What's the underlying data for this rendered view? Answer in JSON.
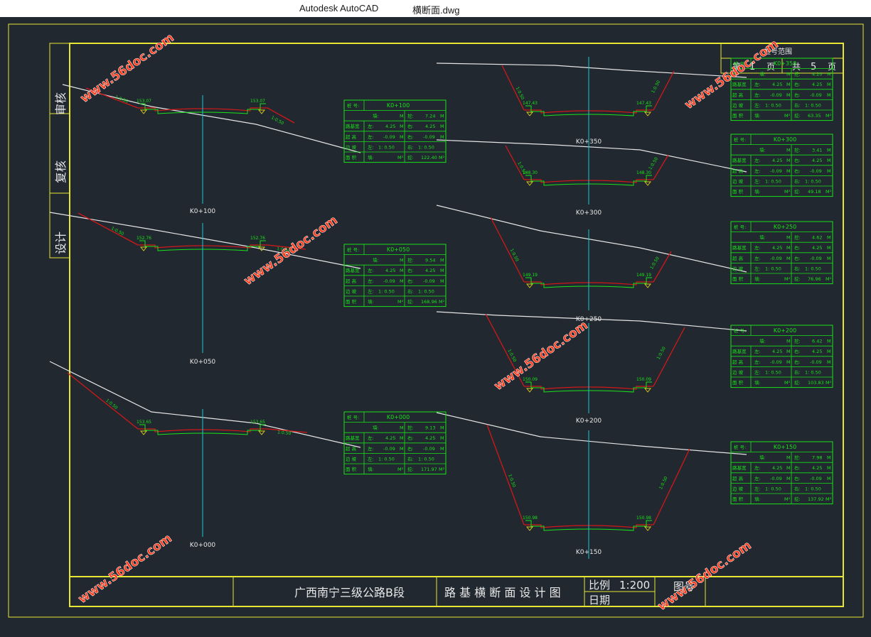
{
  "window": {
    "app_title": "Autodesk AutoCAD",
    "document_title": "横断面.dwg"
  },
  "colors": {
    "background": "#212830",
    "frame": "#e6e633",
    "cut_slope": "#d11818",
    "ground_line": "#e5e5e5",
    "centerline": "#19c8d2",
    "table": "#19e219",
    "watermark": "#ff3a1a"
  },
  "side_labels": {
    "review": "审核",
    "recheck": "复核",
    "design": "设计"
  },
  "title_block": {
    "project": "广西南宁三级公路B段",
    "drawing_name": "路 基 横 断 面 设 计 图",
    "scale_label": "比例",
    "scale_value": "1:200",
    "date_label": "日期",
    "drawing_no_label": "图号"
  },
  "page_box": {
    "header": "桩号范围",
    "page_prefix": "第",
    "page_no": "1",
    "page_unit": "页",
    "total_prefix": "共",
    "total_pages": "5",
    "total_unit": "页"
  },
  "watermark": "www.56doc.com",
  "table_labels": {
    "r0": [
      "桩 号:"
    ],
    "r1": [
      "填:",
      "M",
      "挖:",
      "M"
    ],
    "r2": [
      "路基宽",
      "左:",
      "M",
      "右:",
      "M"
    ],
    "r3": [
      "超 高",
      "左:",
      "M",
      "右:",
      "M"
    ],
    "r4": [
      "边 坡",
      "左:",
      "右:"
    ],
    "r5": [
      "面 积",
      "填:",
      "M²",
      "挖:",
      "M²"
    ]
  },
  "sections": [
    {
      "station": "K0+100",
      "dig": "7.24",
      "width_left": "4.25",
      "width_right": "4.25",
      "superelev_left": "-0.09",
      "superelev_right": "-0.09",
      "slope_left": "1: 0.50",
      "slope_right": "1: 0.50",
      "area_cut": "122.40",
      "elev_left": "153.07",
      "elev_right": "153.07",
      "slope_text_left": "1:0.50",
      "slope_text_right": "1:0.50"
    },
    {
      "station": "K0+050",
      "dig": "9.54",
      "width_left": "4.25",
      "width_right": "4.25",
      "superelev_left": "-0.09",
      "superelev_right": "-0.09",
      "slope_left": "1: 0.50",
      "slope_right": "1: 0.50",
      "area_cut": "168.96",
      "elev_left": "152.76",
      "elev_right": "152.76",
      "slope_text_left": "1:0.50",
      "slope_text_right": "1:0.50"
    },
    {
      "station": "K0+000",
      "dig": "9.13",
      "width_left": "4.25",
      "width_right": "4.25",
      "superelev_left": "-0.09",
      "superelev_right": "-0.09",
      "slope_left": "1: 0.50",
      "slope_right": "1: 0.50",
      "area_cut": "171.97",
      "elev_left": "153.65",
      "elev_right": "153.65",
      "slope_text_left": "1:0.50",
      "slope_text_right": "1:0.50"
    },
    {
      "station": "K0+350",
      "dig": "4.20",
      "width_left": "4.25",
      "width_right": "4.25",
      "superelev_left": "-0.09",
      "superelev_right": "-0.09",
      "slope_left": "1: 0.50",
      "slope_right": "1: 0.50",
      "area_cut": "63.35",
      "elev_left": "147.43",
      "elev_right": "147.43",
      "slope_text_left": "1:0.50",
      "slope_text_right": "1:0.50"
    },
    {
      "station": "K0+300",
      "dig": "3.41",
      "width_left": "4.25",
      "width_right": "4.25",
      "superelev_left": "-0.09",
      "superelev_right": "-0.09",
      "slope_left": "1: 0.50",
      "slope_right": "1: 0.50",
      "area_cut": "49.18",
      "elev_left": "148.30",
      "elev_right": "148.30",
      "slope_text_left": "1:0.50",
      "slope_text_right": "1:0.50"
    },
    {
      "station": "K0+250",
      "dig": "4.62",
      "width_left": "4.25",
      "width_right": "4.25",
      "superelev_left": "-0.09",
      "superelev_right": "-0.09",
      "slope_left": "1: 0.50",
      "slope_right": "1: 0.50",
      "area_cut": "76.96",
      "elev_left": "149.19",
      "elev_right": "149.19",
      "slope_text_left": "1:0.50",
      "slope_text_right": "1:0.50"
    },
    {
      "station": "K0+200",
      "dig": "6.42",
      "width_left": "4.25",
      "width_right": "4.25",
      "superelev_left": "-0.09",
      "superelev_right": "-0.09",
      "slope_left": "1: 0.50",
      "slope_right": "1: 0.50",
      "area_cut": "103.83",
      "elev_left": "150.09",
      "elev_right": "150.09",
      "slope_text_left": "1:0.50",
      "slope_text_right": "1:0.50"
    },
    {
      "station": "K0+150",
      "dig": "7.98",
      "width_left": "4.25",
      "width_right": "4.25",
      "superelev_left": "-0.09",
      "superelev_right": "-0.09",
      "slope_left": "1: 0.50",
      "slope_right": "1: 0.50",
      "area_cut": "137.92",
      "elev_left": "150.98",
      "elev_right": "150.98",
      "slope_text_left": "1:0.50",
      "slope_text_right": "1:0.50"
    }
  ]
}
